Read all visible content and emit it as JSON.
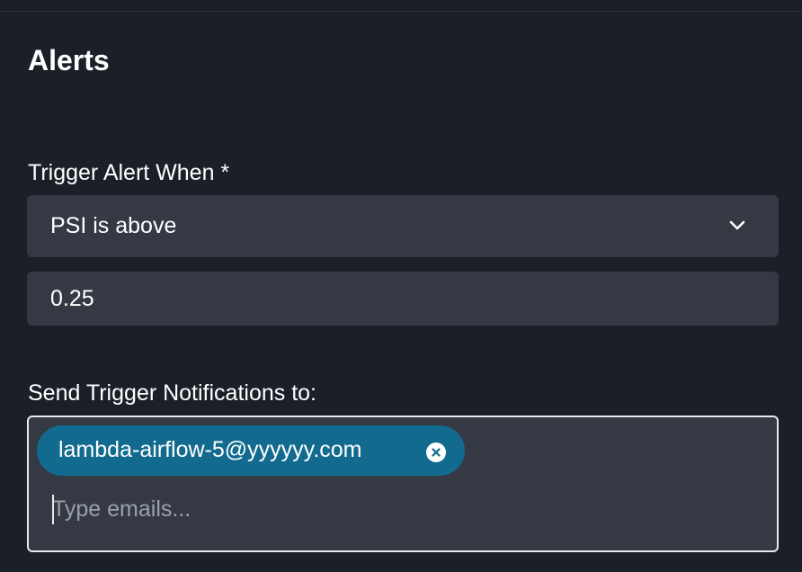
{
  "alerts": {
    "title": "Alerts",
    "trigger": {
      "label": "Trigger Alert When *",
      "selected_condition": "PSI is above",
      "threshold_value": "0.25"
    },
    "notifications": {
      "label": "Send Trigger Notifications to:",
      "recipients": [
        "lambda-airflow-5@yyyyyy.com"
      ],
      "input_placeholder": "Type emails..."
    }
  },
  "icons": {
    "select_toggle": "chevron-down-icon",
    "chip_remove": "close-circle-icon"
  },
  "colors": {
    "background": "#1b1f28",
    "field_background": "#343944",
    "chip": "#126b8f",
    "focus_border": "#e6e8eb",
    "placeholder": "#9aa0aa"
  }
}
